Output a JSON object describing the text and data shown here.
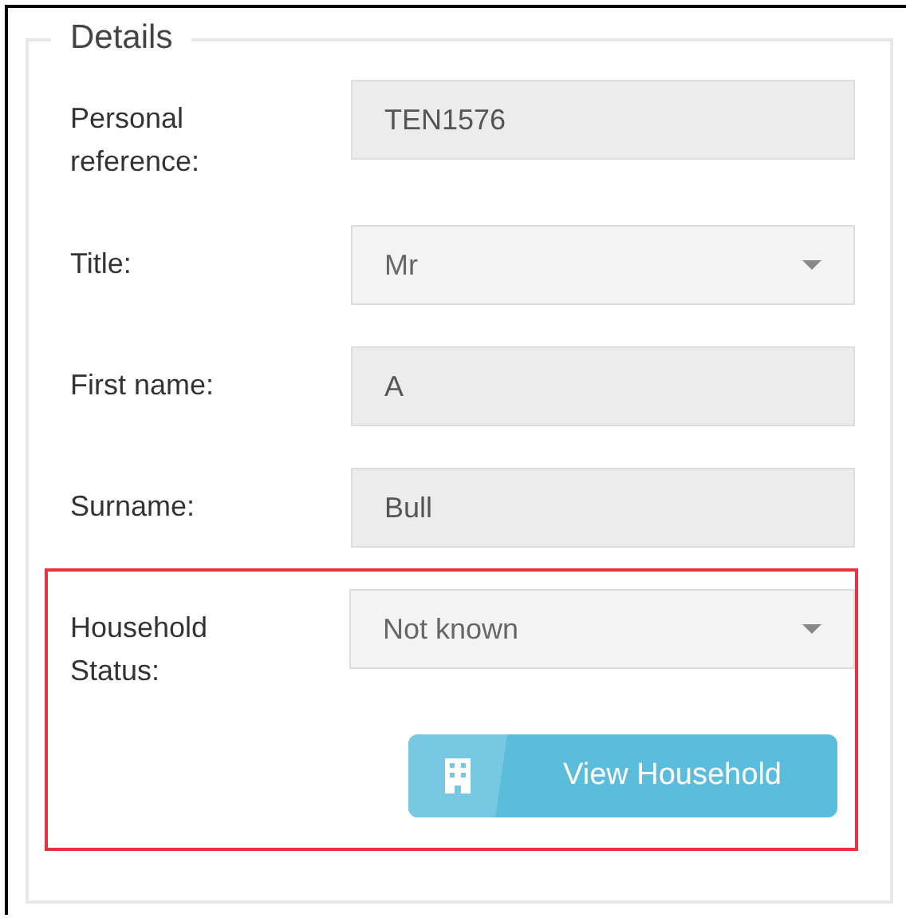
{
  "fieldset": {
    "legend": "Details",
    "sections": [
      {
        "highlighted": false,
        "fields": [
          {
            "label": "Personal reference:",
            "kind": "input",
            "value": "TEN1576"
          },
          {
            "label": "Title:",
            "kind": "select",
            "value": "Mr"
          },
          {
            "label": "First name:",
            "kind": "input",
            "value": "A"
          },
          {
            "label": "Surname:",
            "kind": "input",
            "value": "Bull"
          }
        ]
      },
      {
        "highlighted": true,
        "fields": [
          {
            "label": "Household Status:",
            "kind": "select",
            "value": "Not known"
          }
        ],
        "button": {
          "label": "View Household"
        }
      }
    ]
  }
}
